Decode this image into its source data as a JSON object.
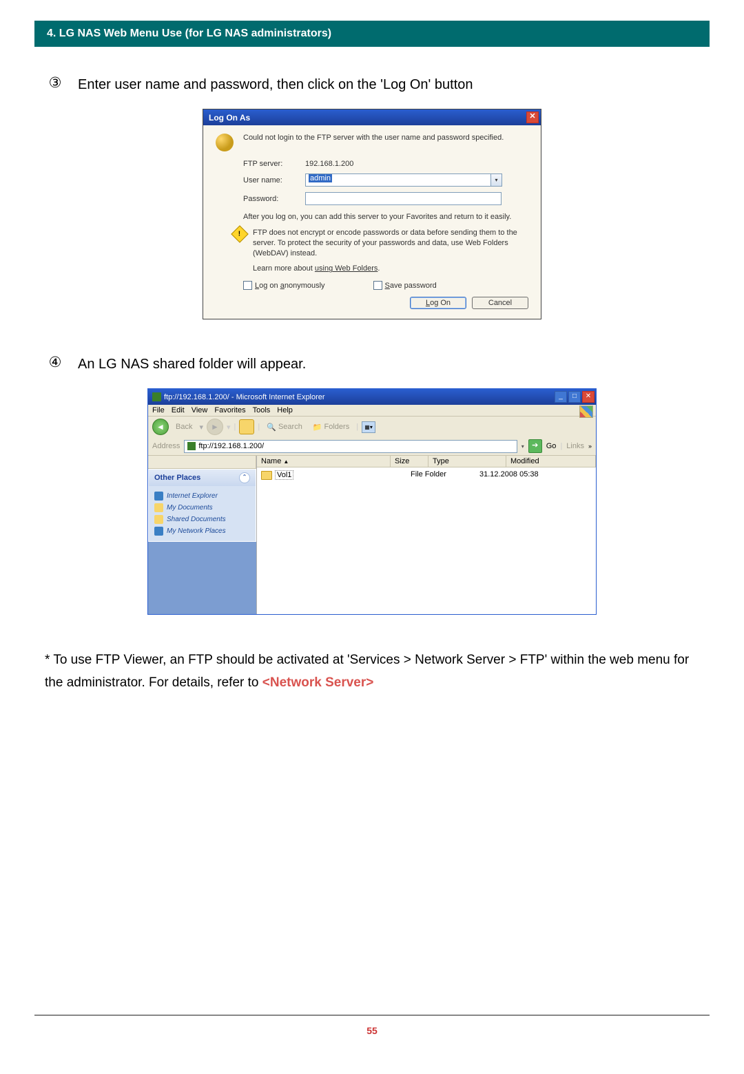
{
  "header": "4. LG NAS Web Menu Use (for LG NAS administrators)",
  "step3": {
    "num": "③",
    "text": "Enter user name and password, then click on the 'Log On' button"
  },
  "logon": {
    "title": "Log On As",
    "error": "Could not login to the FTP server with the user name and password specified.",
    "ftp_label": "FTP server:",
    "ftp_value": "192.168.1.200",
    "user_label": "User name:",
    "user_value": "admin",
    "pass_label": "Password:",
    "after": "After you log on, you can add this server to your Favorites and return to it easily.",
    "warning": "FTP does not encrypt or encode passwords or data before sending them to the server.  To protect the security of your passwords and data, use Web Folders (WebDAV) instead.",
    "learn_pre": "Learn more about ",
    "learn_link": "using Web Folders",
    "chk_anon": "Log on anonymously",
    "chk_save": "Save password",
    "btn_logon": "Log On",
    "btn_cancel": "Cancel"
  },
  "step4": {
    "num": "④",
    "text": "An LG NAS shared folder will appear."
  },
  "explorer": {
    "title": "ftp://192.168.1.200/ - Microsoft Internet Explorer",
    "menu": {
      "file": "File",
      "edit": "Edit",
      "view": "View",
      "fav": "Favorites",
      "tools": "Tools",
      "help": "Help"
    },
    "tb": {
      "back": "Back",
      "search": "Search",
      "folders": "Folders"
    },
    "addr_label": "Address",
    "addr_value": "ftp://192.168.1.200/",
    "go": "Go",
    "links": "Links",
    "cols": {
      "name": "Name",
      "size": "Size",
      "type": "Type",
      "mod": "Modified"
    },
    "panel_title": "Other Places",
    "panel_links": {
      "ie": "Internet Explorer",
      "docs": "My Documents",
      "shared": "Shared Documents",
      "net": "My Network Places"
    },
    "item": {
      "name": "Vol1",
      "type": "File Folder",
      "mod": "31.12.2008 05:38"
    }
  },
  "footnote": {
    "text_pre": "* To use FTP Viewer, an FTP should be activated at 'Services > Network Server > FTP' within the web menu for the administrator. For details, refer to ",
    "link": "<Network Server>"
  },
  "page_num": "55"
}
